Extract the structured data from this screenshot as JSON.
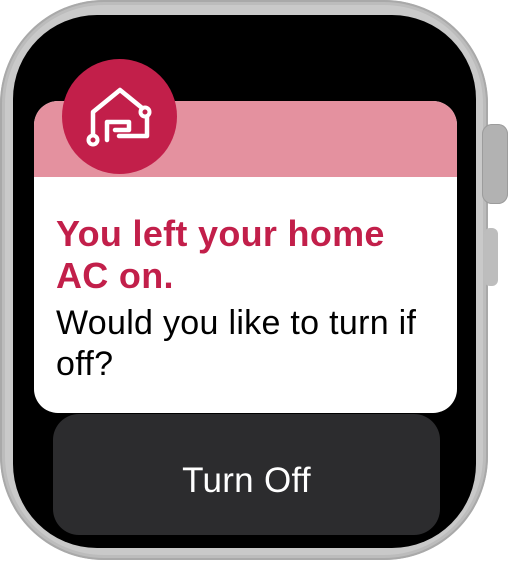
{
  "notification": {
    "app_icon": "home-icon",
    "title": "You left your home AC on.",
    "message": "Would you like to turn if off?"
  },
  "actions": {
    "primary_label": "Turn Off"
  },
  "colors": {
    "accent": "#c21f4a",
    "header_tint": "#e4919f",
    "card_background": "#ffffff",
    "button_background": "#2c2c2e",
    "screen_background": "#000000",
    "case": "#c9c9c9"
  }
}
